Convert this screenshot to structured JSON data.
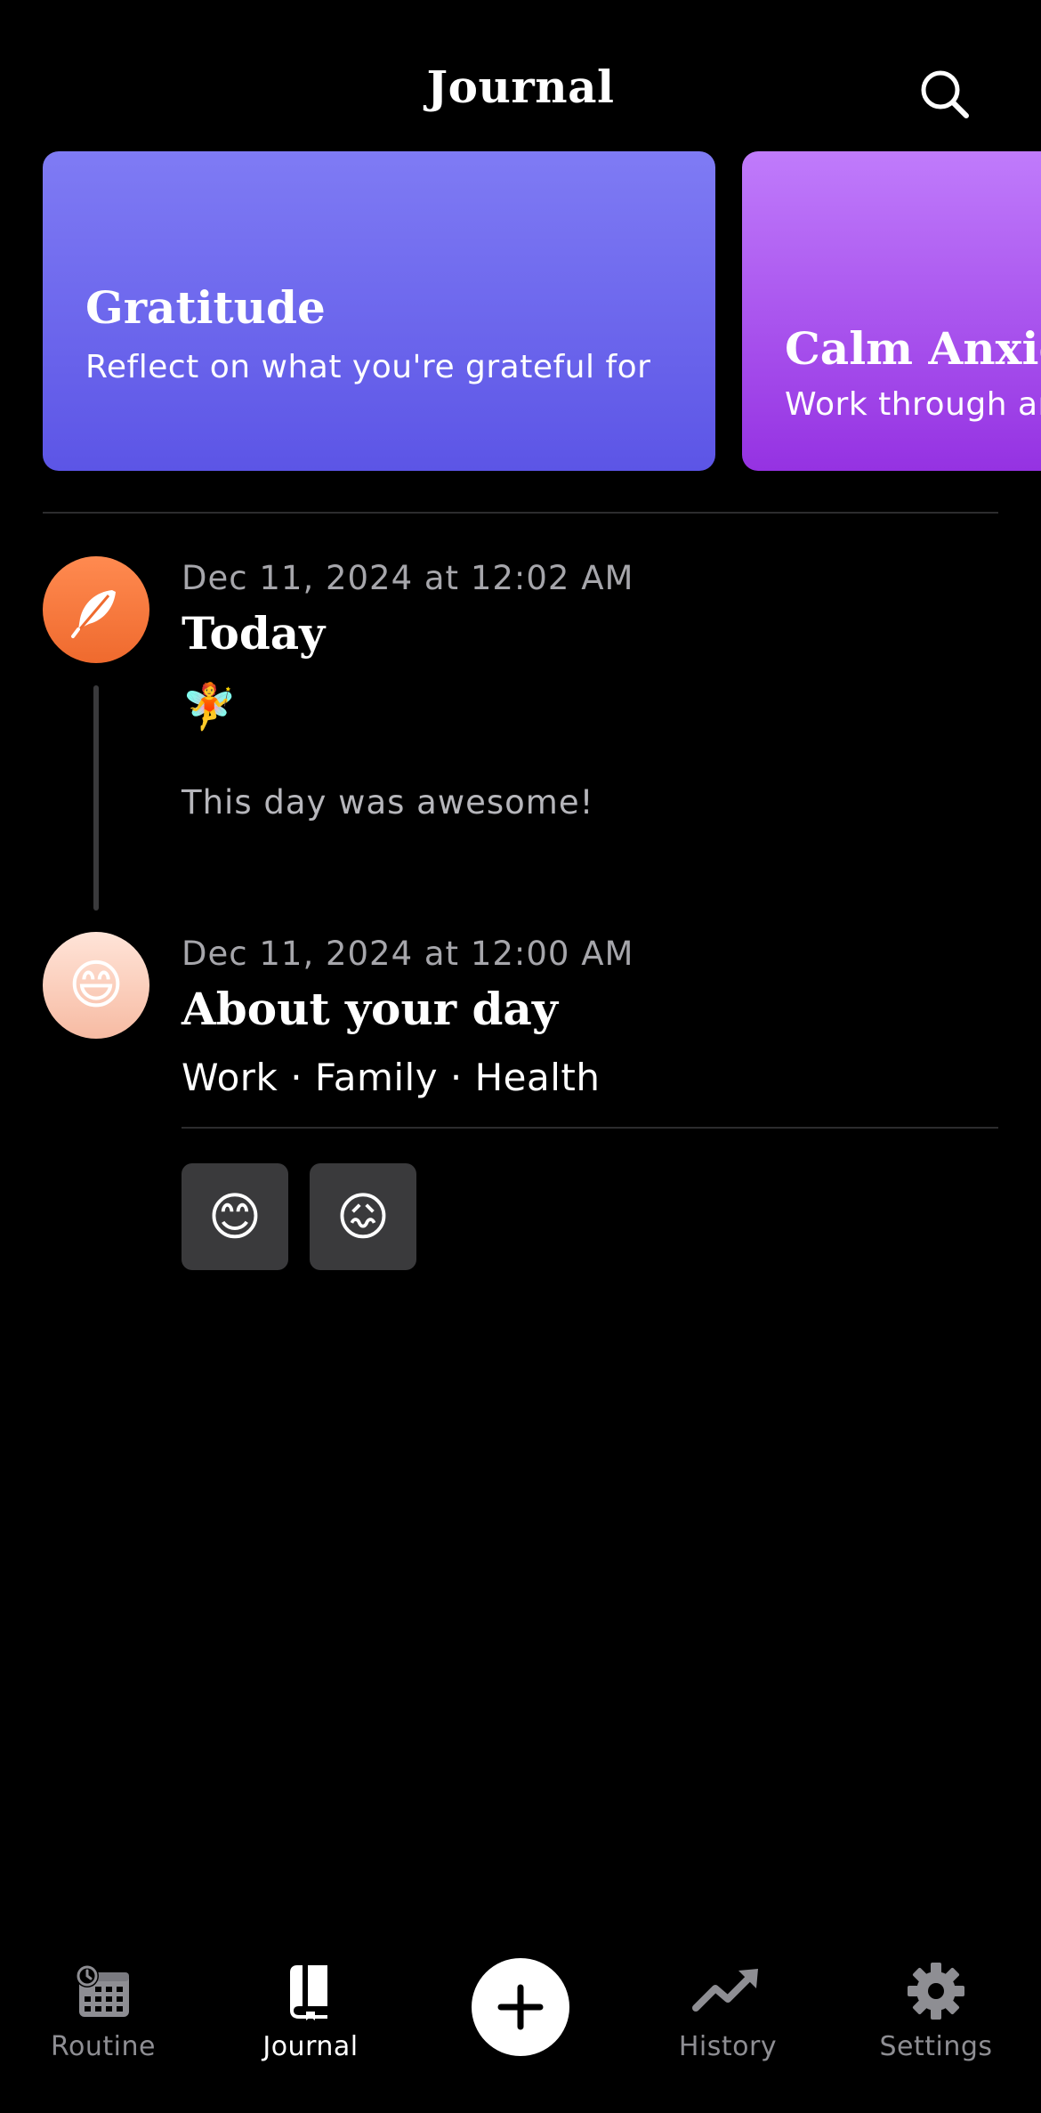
{
  "header": {
    "title": "Journal",
    "search_icon": "search-icon"
  },
  "prompt_cards": [
    {
      "title": "Gratitude",
      "description": "Reflect on what you're grateful for",
      "gradient": [
        "#7f7bf4",
        "#5c55e6"
      ]
    },
    {
      "title": "Calm Anxiety",
      "description": "Work through anxious thoughts",
      "gradient": [
        "#c07bfb",
        "#9532e2"
      ]
    }
  ],
  "entries": [
    {
      "icon": "feather-icon",
      "icon_color": "#f07a3e",
      "date": "Dec 11, 2024 at 12:02 AM",
      "title": "Today",
      "emoji": "🧚",
      "body": "This day was awesome!"
    },
    {
      "icon": "😄",
      "date": "Dec 11, 2024 at 12:00 AM",
      "title": "About your day",
      "tags": "Work · Family · Health",
      "moods": [
        "😊",
        "😖"
      ]
    }
  ],
  "tabbar": {
    "items": [
      {
        "label": "Routine",
        "icon": "calendar-clock-icon",
        "active": false
      },
      {
        "label": "Journal",
        "icon": "book-icon",
        "active": true
      },
      {
        "label": "History",
        "icon": "trending-up-icon",
        "active": false
      },
      {
        "label": "Settings",
        "icon": "gear-icon",
        "active": false
      }
    ],
    "add_icon": "plus-icon"
  }
}
